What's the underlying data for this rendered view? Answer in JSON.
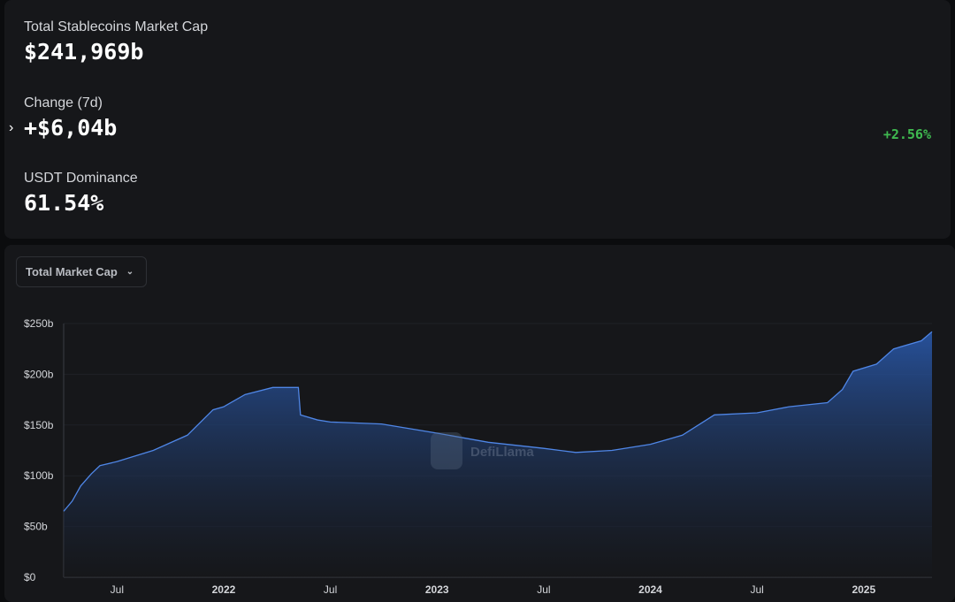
{
  "stats": {
    "market_cap_label": "Total Stablecoins Market Cap",
    "market_cap_value": "$241,969b",
    "change_label": "Change (7d)",
    "change_value": "+$6,04b",
    "change_pct": "+2.56%",
    "dominance_label": "USDT Dominance",
    "dominance_value": "61.54%"
  },
  "dropdown": {
    "label": "Total Market Cap"
  },
  "watermark": "DefiLlama",
  "colors": {
    "line": "#4f86e6",
    "positive": "#3fb950"
  },
  "chart_data": {
    "type": "area",
    "title": "",
    "xlabel": "",
    "ylabel": "",
    "ylim": [
      0,
      250
    ],
    "xlim": [
      2021.25,
      2025.32
    ],
    "y_ticks": [
      {
        "v": 0,
        "l": "$0"
      },
      {
        "v": 50,
        "l": "$50b"
      },
      {
        "v": 100,
        "l": "$100b"
      },
      {
        "v": 150,
        "l": "$150b"
      },
      {
        "v": 200,
        "l": "$200b"
      },
      {
        "v": 250,
        "l": "$250b"
      }
    ],
    "x_ticks": [
      {
        "v": 2021.5,
        "l": "Jul"
      },
      {
        "v": 2022,
        "l": "2022",
        "bold": true
      },
      {
        "v": 2022.5,
        "l": "Jul"
      },
      {
        "v": 2023,
        "l": "2023",
        "bold": true
      },
      {
        "v": 2023.5,
        "l": "Jul"
      },
      {
        "v": 2024,
        "l": "2024",
        "bold": true
      },
      {
        "v": 2024.5,
        "l": "Jul"
      },
      {
        "v": 2025,
        "l": "2025",
        "bold": true
      }
    ],
    "series": [
      {
        "name": "Total Market Cap",
        "x": [
          2021.25,
          2021.29,
          2021.33,
          2021.38,
          2021.42,
          2021.5,
          2021.67,
          2021.83,
          2021.95,
          2022.0,
          2022.1,
          2022.23,
          2022.35,
          2022.36,
          2022.44,
          2022.5,
          2022.74,
          2023.0,
          2023.24,
          2023.5,
          2023.65,
          2023.82,
          2024.0,
          2024.15,
          2024.3,
          2024.5,
          2024.65,
          2024.83,
          2024.9,
          2024.95,
          2025.06,
          2025.14,
          2025.27,
          2025.32
        ],
        "values": [
          65,
          75,
          90,
          102,
          110,
          114,
          125,
          140,
          165,
          168,
          180,
          187,
          187,
          160,
          155,
          153,
          151,
          142,
          133,
          127,
          123,
          125,
          131,
          140,
          160,
          162,
          168,
          172,
          185,
          203,
          210,
          225,
          233,
          242
        ]
      }
    ]
  }
}
